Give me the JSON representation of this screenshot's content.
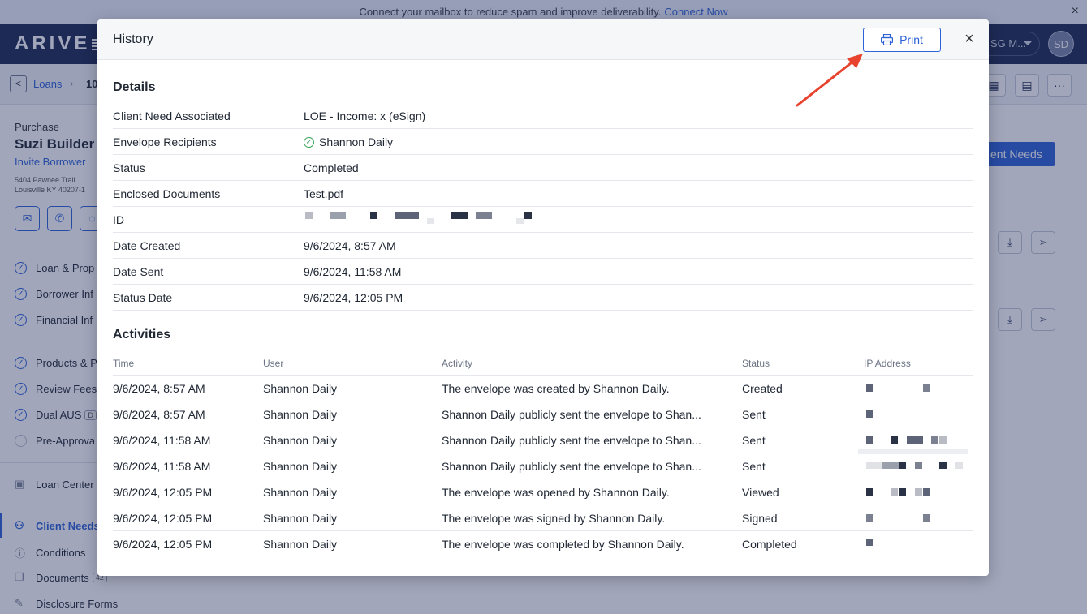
{
  "banner": {
    "text": "Connect your mailbox to reduce spam and improve deliverability.",
    "link": "Connect Now",
    "close": "×"
  },
  "app": {
    "logo": "ARIVE",
    "workspace": "SG M...",
    "avatar": "SD"
  },
  "breadcrumb": {
    "loans": "Loans",
    "loan_id": "10"
  },
  "sidebar": {
    "loan_type": "Purchase",
    "borrower_name": "Suzi Builder",
    "invite": "Invite Borrower",
    "address_line1": "5404 Pawnee Trail",
    "address_line2": "Louisville KY 40207-1",
    "group1": [
      "Loan & Prop",
      "Borrower Inf",
      "Financial Inf"
    ],
    "group2": [
      "Products & P",
      "Review Fees",
      "Dual AUS",
      "Pre-Approva"
    ],
    "dual_aus_badge": "D",
    "group3": [
      "Loan Center",
      "Client Needs",
      "Conditions",
      "Documents",
      "Disclosure Forms"
    ],
    "documents_badge": "42"
  },
  "main": {
    "client_needs_button": "ent Needs"
  },
  "modal": {
    "title": "History",
    "print_label": "Print",
    "close": "×",
    "details_title": "Details",
    "details": [
      {
        "label": "Client Need Associated",
        "value": "LOE - Income: x (eSign)"
      },
      {
        "label": "Envelope Recipients",
        "value": "Shannon Daily"
      },
      {
        "label": "Status",
        "value": "Completed"
      },
      {
        "label": "Enclosed Documents",
        "value": "Test.pdf"
      },
      {
        "label": "ID",
        "value": ""
      },
      {
        "label": "Date Created",
        "value": "9/6/2024, 8:57 AM"
      },
      {
        "label": "Date Sent",
        "value": "9/6/2024, 11:58 AM"
      },
      {
        "label": "Status Date",
        "value": "9/6/2024, 12:05 PM"
      }
    ],
    "activities_title": "Activities",
    "activity_columns": [
      "Time",
      "User",
      "Activity",
      "Status",
      "IP Address"
    ],
    "activities": [
      {
        "time": "9/6/2024, 8:57 AM",
        "user": "Shannon Daily",
        "activity": "The envelope was created by Shannon Daily.",
        "status": "Created"
      },
      {
        "time": "9/6/2024, 8:57 AM",
        "user": "Shannon Daily",
        "activity": "Shannon Daily publicly sent the envelope to Shan...",
        "status": "Sent"
      },
      {
        "time": "9/6/2024, 11:58 AM",
        "user": "Shannon Daily",
        "activity": "Shannon Daily publicly sent the envelope to Shan...",
        "status": "Sent"
      },
      {
        "time": "9/6/2024, 11:58 AM",
        "user": "Shannon Daily",
        "activity": "Shannon Daily publicly sent the envelope to Shan...",
        "status": "Sent"
      },
      {
        "time": "9/6/2024, 12:05 PM",
        "user": "Shannon Daily",
        "activity": "The envelope was opened by Shannon Daily.",
        "status": "Viewed"
      },
      {
        "time": "9/6/2024, 12:05 PM",
        "user": "Shannon Daily",
        "activity": "The envelope was signed by Shannon Daily.",
        "status": "Signed"
      },
      {
        "time": "9/6/2024, 12:05 PM",
        "user": "Shannon Daily",
        "activity": "The envelope was completed by Shannon Daily.",
        "status": "Completed"
      }
    ]
  },
  "colors": {
    "accent": "#2d62d8",
    "navy": "#1d2a52",
    "annotation_arrow": "#e8432e",
    "success": "#3aa65a"
  }
}
